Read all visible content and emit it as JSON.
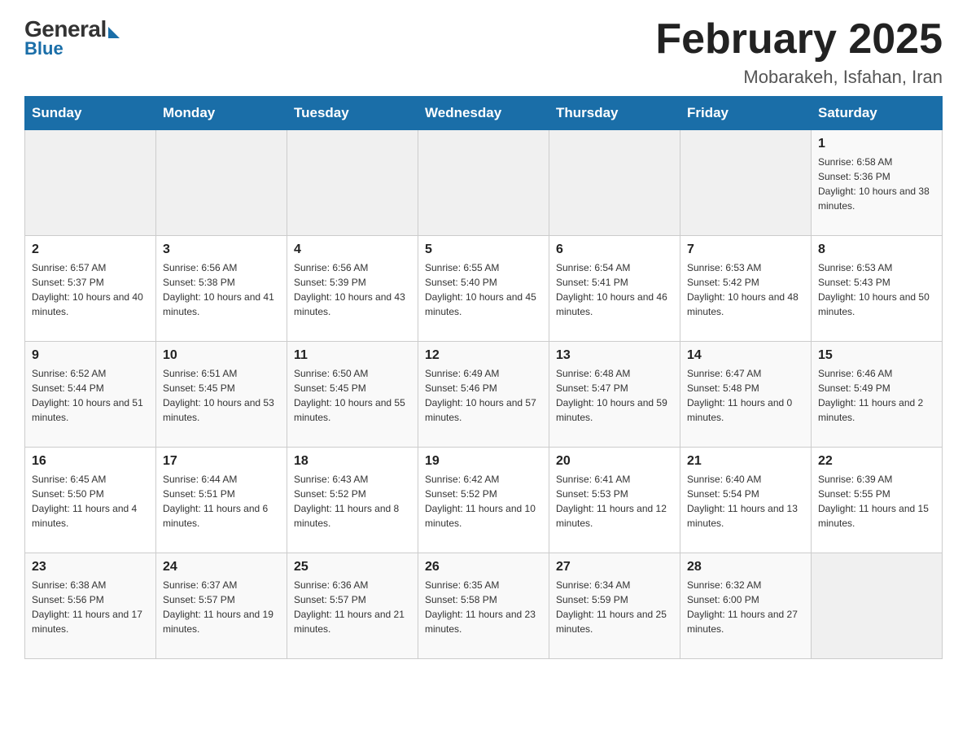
{
  "header": {
    "logo_general": "General",
    "logo_blue": "Blue",
    "calendar_title": "February 2025",
    "calendar_subtitle": "Mobarakeh, Isfahan, Iran"
  },
  "days_of_week": [
    "Sunday",
    "Monday",
    "Tuesday",
    "Wednesday",
    "Thursday",
    "Friday",
    "Saturday"
  ],
  "weeks": [
    [
      {
        "day": "",
        "sunrise": "",
        "sunset": "",
        "daylight": ""
      },
      {
        "day": "",
        "sunrise": "",
        "sunset": "",
        "daylight": ""
      },
      {
        "day": "",
        "sunrise": "",
        "sunset": "",
        "daylight": ""
      },
      {
        "day": "",
        "sunrise": "",
        "sunset": "",
        "daylight": ""
      },
      {
        "day": "",
        "sunrise": "",
        "sunset": "",
        "daylight": ""
      },
      {
        "day": "",
        "sunrise": "",
        "sunset": "",
        "daylight": ""
      },
      {
        "day": "1",
        "sunrise": "Sunrise: 6:58 AM",
        "sunset": "Sunset: 5:36 PM",
        "daylight": "Daylight: 10 hours and 38 minutes."
      }
    ],
    [
      {
        "day": "2",
        "sunrise": "Sunrise: 6:57 AM",
        "sunset": "Sunset: 5:37 PM",
        "daylight": "Daylight: 10 hours and 40 minutes."
      },
      {
        "day": "3",
        "sunrise": "Sunrise: 6:56 AM",
        "sunset": "Sunset: 5:38 PM",
        "daylight": "Daylight: 10 hours and 41 minutes."
      },
      {
        "day": "4",
        "sunrise": "Sunrise: 6:56 AM",
        "sunset": "Sunset: 5:39 PM",
        "daylight": "Daylight: 10 hours and 43 minutes."
      },
      {
        "day": "5",
        "sunrise": "Sunrise: 6:55 AM",
        "sunset": "Sunset: 5:40 PM",
        "daylight": "Daylight: 10 hours and 45 minutes."
      },
      {
        "day": "6",
        "sunrise": "Sunrise: 6:54 AM",
        "sunset": "Sunset: 5:41 PM",
        "daylight": "Daylight: 10 hours and 46 minutes."
      },
      {
        "day": "7",
        "sunrise": "Sunrise: 6:53 AM",
        "sunset": "Sunset: 5:42 PM",
        "daylight": "Daylight: 10 hours and 48 minutes."
      },
      {
        "day": "8",
        "sunrise": "Sunrise: 6:53 AM",
        "sunset": "Sunset: 5:43 PM",
        "daylight": "Daylight: 10 hours and 50 minutes."
      }
    ],
    [
      {
        "day": "9",
        "sunrise": "Sunrise: 6:52 AM",
        "sunset": "Sunset: 5:44 PM",
        "daylight": "Daylight: 10 hours and 51 minutes."
      },
      {
        "day": "10",
        "sunrise": "Sunrise: 6:51 AM",
        "sunset": "Sunset: 5:45 PM",
        "daylight": "Daylight: 10 hours and 53 minutes."
      },
      {
        "day": "11",
        "sunrise": "Sunrise: 6:50 AM",
        "sunset": "Sunset: 5:45 PM",
        "daylight": "Daylight: 10 hours and 55 minutes."
      },
      {
        "day": "12",
        "sunrise": "Sunrise: 6:49 AM",
        "sunset": "Sunset: 5:46 PM",
        "daylight": "Daylight: 10 hours and 57 minutes."
      },
      {
        "day": "13",
        "sunrise": "Sunrise: 6:48 AM",
        "sunset": "Sunset: 5:47 PM",
        "daylight": "Daylight: 10 hours and 59 minutes."
      },
      {
        "day": "14",
        "sunrise": "Sunrise: 6:47 AM",
        "sunset": "Sunset: 5:48 PM",
        "daylight": "Daylight: 11 hours and 0 minutes."
      },
      {
        "day": "15",
        "sunrise": "Sunrise: 6:46 AM",
        "sunset": "Sunset: 5:49 PM",
        "daylight": "Daylight: 11 hours and 2 minutes."
      }
    ],
    [
      {
        "day": "16",
        "sunrise": "Sunrise: 6:45 AM",
        "sunset": "Sunset: 5:50 PM",
        "daylight": "Daylight: 11 hours and 4 minutes."
      },
      {
        "day": "17",
        "sunrise": "Sunrise: 6:44 AM",
        "sunset": "Sunset: 5:51 PM",
        "daylight": "Daylight: 11 hours and 6 minutes."
      },
      {
        "day": "18",
        "sunrise": "Sunrise: 6:43 AM",
        "sunset": "Sunset: 5:52 PM",
        "daylight": "Daylight: 11 hours and 8 minutes."
      },
      {
        "day": "19",
        "sunrise": "Sunrise: 6:42 AM",
        "sunset": "Sunset: 5:52 PM",
        "daylight": "Daylight: 11 hours and 10 minutes."
      },
      {
        "day": "20",
        "sunrise": "Sunrise: 6:41 AM",
        "sunset": "Sunset: 5:53 PM",
        "daylight": "Daylight: 11 hours and 12 minutes."
      },
      {
        "day": "21",
        "sunrise": "Sunrise: 6:40 AM",
        "sunset": "Sunset: 5:54 PM",
        "daylight": "Daylight: 11 hours and 13 minutes."
      },
      {
        "day": "22",
        "sunrise": "Sunrise: 6:39 AM",
        "sunset": "Sunset: 5:55 PM",
        "daylight": "Daylight: 11 hours and 15 minutes."
      }
    ],
    [
      {
        "day": "23",
        "sunrise": "Sunrise: 6:38 AM",
        "sunset": "Sunset: 5:56 PM",
        "daylight": "Daylight: 11 hours and 17 minutes."
      },
      {
        "day": "24",
        "sunrise": "Sunrise: 6:37 AM",
        "sunset": "Sunset: 5:57 PM",
        "daylight": "Daylight: 11 hours and 19 minutes."
      },
      {
        "day": "25",
        "sunrise": "Sunrise: 6:36 AM",
        "sunset": "Sunset: 5:57 PM",
        "daylight": "Daylight: 11 hours and 21 minutes."
      },
      {
        "day": "26",
        "sunrise": "Sunrise: 6:35 AM",
        "sunset": "Sunset: 5:58 PM",
        "daylight": "Daylight: 11 hours and 23 minutes."
      },
      {
        "day": "27",
        "sunrise": "Sunrise: 6:34 AM",
        "sunset": "Sunset: 5:59 PM",
        "daylight": "Daylight: 11 hours and 25 minutes."
      },
      {
        "day": "28",
        "sunrise": "Sunrise: 6:32 AM",
        "sunset": "Sunset: 6:00 PM",
        "daylight": "Daylight: 11 hours and 27 minutes."
      },
      {
        "day": "",
        "sunrise": "",
        "sunset": "",
        "daylight": ""
      }
    ]
  ]
}
